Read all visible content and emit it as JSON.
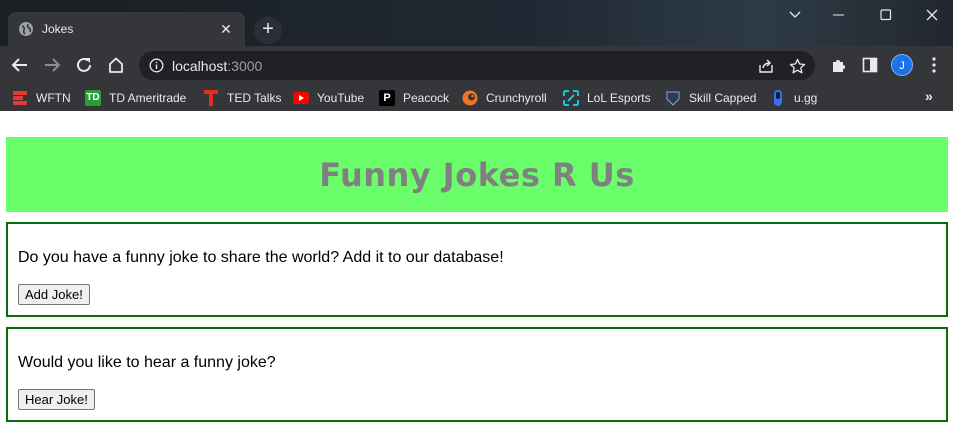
{
  "browser": {
    "tab": {
      "title": "Jokes",
      "close_glyph": "✕"
    },
    "new_tab_glyph": "+",
    "url": {
      "host": "localhost",
      "port": ":3000"
    },
    "profile_initial": "J",
    "bookmarks": [
      {
        "label": "WFTN",
        "icon": "wftn-icon",
        "color": "#e53935"
      },
      {
        "label": "TD Ameritrade",
        "icon": "td-ameritrade-icon",
        "color": "#2e9b3a"
      },
      {
        "label": "TED Talks",
        "icon": "ted-icon",
        "color": "#e62b1e"
      },
      {
        "label": "YouTube",
        "icon": "youtube-icon",
        "color": "#ff0000"
      },
      {
        "label": "Peacock",
        "icon": "peacock-icon",
        "color": "#000000"
      },
      {
        "label": "Crunchyroll",
        "icon": "crunchyroll-icon",
        "color": "#f47521"
      },
      {
        "label": "LoL Esports",
        "icon": "lol-esports-icon",
        "color": "#17c3d6"
      },
      {
        "label": "Skill Capped",
        "icon": "skill-capped-icon",
        "color": "#2b3a55"
      },
      {
        "label": "u.gg",
        "icon": "ugg-icon",
        "color": "#3b6cf6"
      }
    ],
    "more_bookmarks_glyph": "»"
  },
  "page": {
    "title": "Funny Jokes R Us",
    "add_section": {
      "prompt": "Do you have a funny joke to share the world? Add it to our database!",
      "button": "Add Joke!"
    },
    "hear_section": {
      "prompt": "Would you like to hear a funny joke?",
      "button": "Hear Joke!"
    }
  },
  "colors": {
    "banner_bg": "#6bfe6b",
    "banner_text": "#808080",
    "card_border": "#0a6b0a"
  }
}
